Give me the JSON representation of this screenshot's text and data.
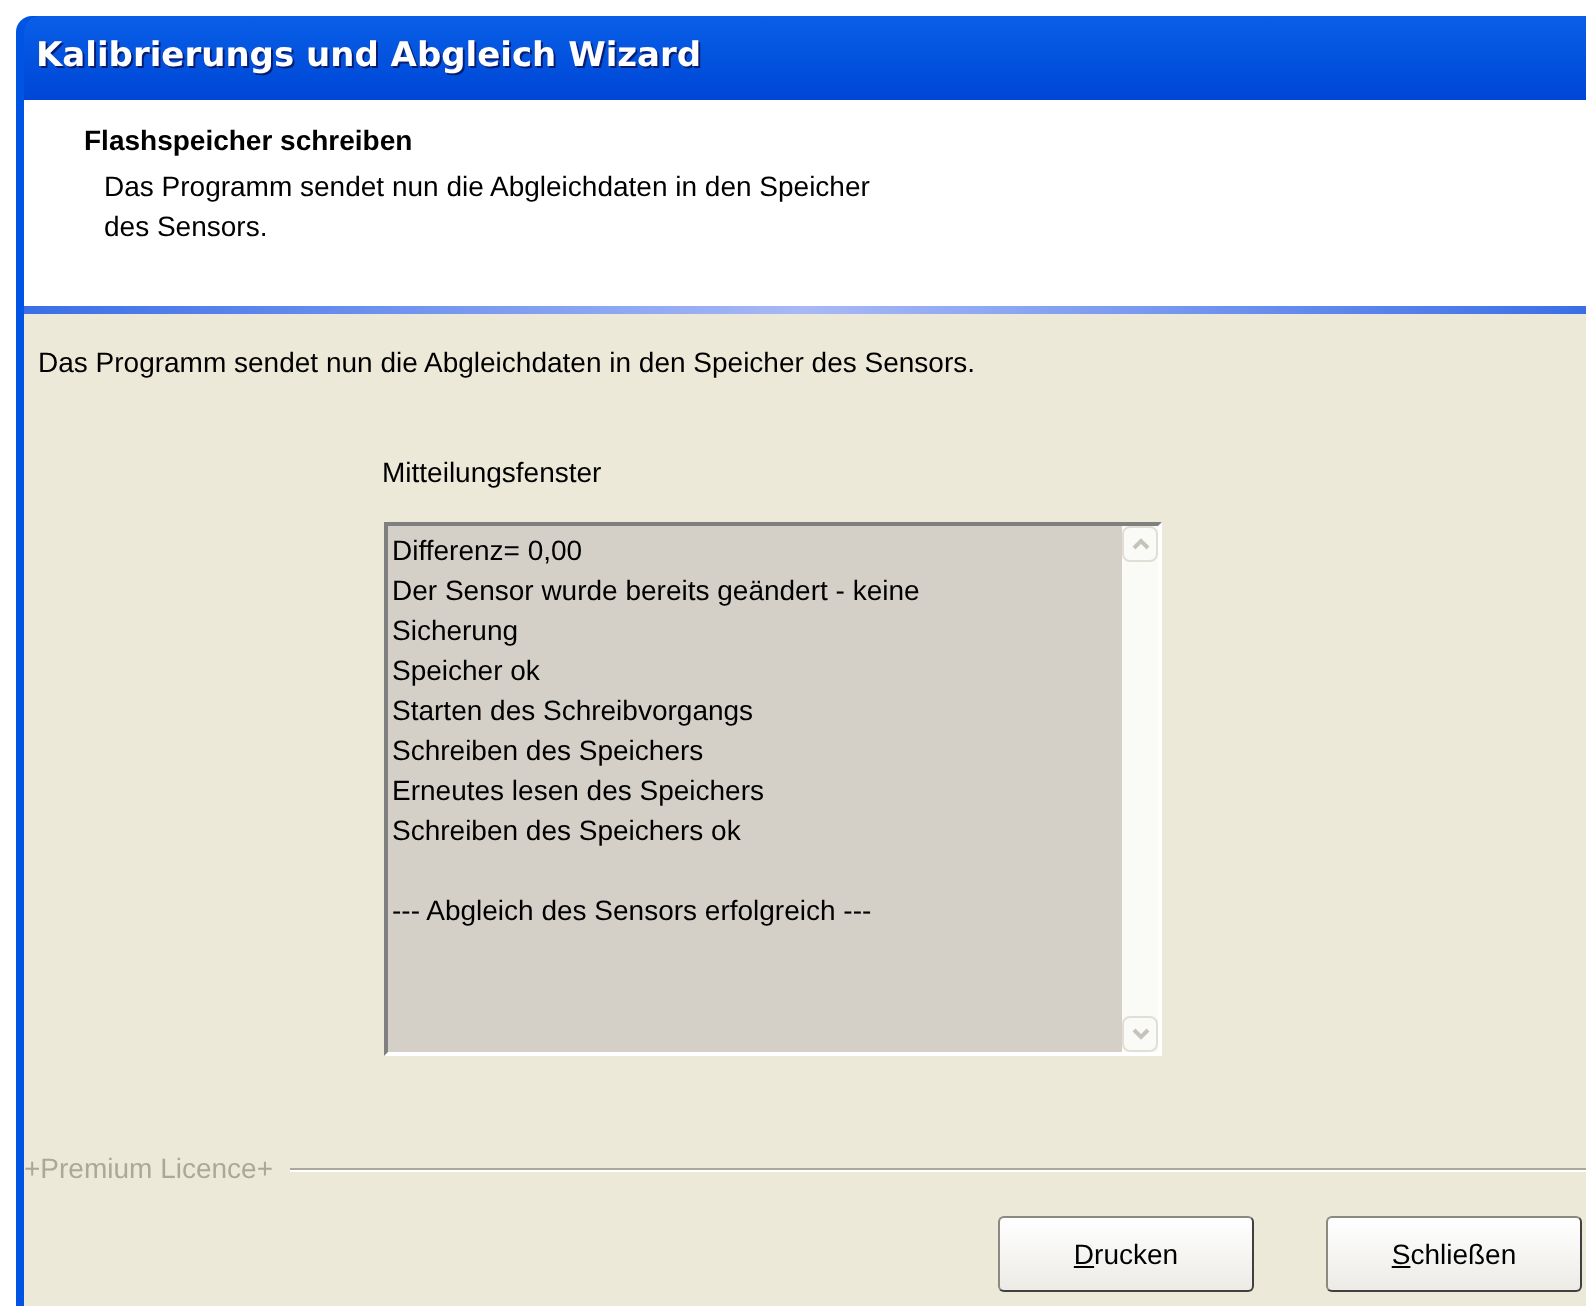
{
  "window": {
    "title": "Kalibrierungs und Abgleich Wizard"
  },
  "header": {
    "title": "Flashspeicher schreiben",
    "subtitle": "Das Programm sendet nun die Abgleichdaten in den Speicher des Sensors."
  },
  "intro": "Das Programm sendet nun die Abgleichdaten in den Speicher des Sensors.",
  "messages": {
    "label": "Mitteilungsfenster",
    "disabled": true,
    "lines": [
      "Differenz= 0,00",
      "Der Sensor wurde bereits geändert - keine Sicherung",
      "Speicher ok",
      "Starten des Schreibvorgangs",
      "Schreiben des Speichers",
      "Erneutes lesen des Speichers",
      "Schreiben des Speichers ok"
    ],
    "result": "--- Abgleich des Sensors erfolgreich ---"
  },
  "licence": "+Premium Licence+",
  "buttons": [
    {
      "label": "Drucken",
      "mnemonic_first": true
    },
    {
      "label": "Schließen",
      "mnemonic_first": true
    }
  ]
}
